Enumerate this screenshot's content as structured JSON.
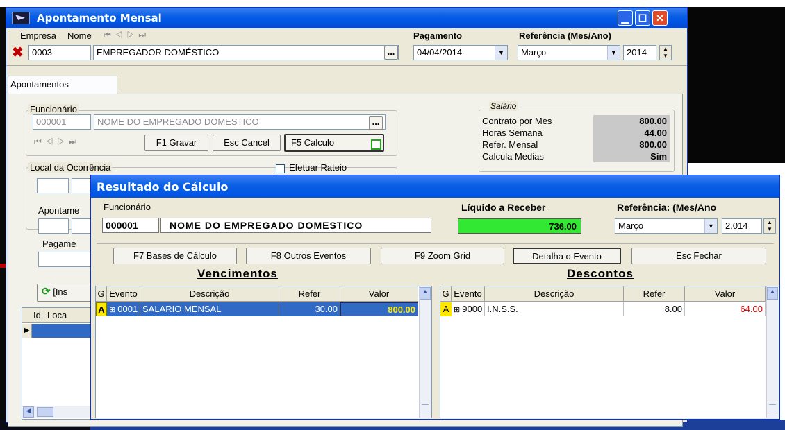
{
  "main_window": {
    "title": "Apontamento Mensal",
    "labels": {
      "empresa": "Empresa",
      "nome": "Nome",
      "pagamento": "Pagamento",
      "referencia": "Referência (Mes/Ano)"
    },
    "empresa_code": "0003",
    "empresa_name": "EMPREGADOR DOMÉSTICO",
    "ellipsis": "...",
    "pagamento_date": "04/04/2014",
    "ref_month": "Março",
    "ref_year": "2014",
    "tab": "Apontamentos",
    "funcionario": {
      "label": "Funcionário",
      "code": "000001",
      "name": "NOME DO EMPREGADO DOMESTICO"
    },
    "buttons": {
      "gravar": "F1 Gravar",
      "cancel": "Esc Cancel",
      "calculo": "F5 Calculo"
    },
    "salario": {
      "title": "Salário",
      "rows": [
        {
          "label": "Contrato por Mes",
          "value": "800.00"
        },
        {
          "label": "Horas Semana",
          "value": "44.00"
        },
        {
          "label": "Refer. Mensal",
          "value": "800.00"
        },
        {
          "label": "Calcula Medias",
          "value": "Sim"
        }
      ]
    },
    "local": "Local da Ocorrência",
    "efetuar_rateio": "Efetuar Rateio",
    "apontamento_cut": "Apontame",
    "pagamento_cut": "Pagame",
    "insert_cut": "[Ins",
    "grid_headers": {
      "id": "Id",
      "loc": "Loca"
    }
  },
  "dialog": {
    "title": "Resultado do Cálculo",
    "labels": {
      "funcionario": "Funcionário",
      "liquido": "Líquido a Receber",
      "referencia": "Referência: (Mes/Ano"
    },
    "func_code": "000001",
    "func_name": "NOME DO EMPREGADO DOMESTICO",
    "liquido_value": "736.00",
    "ref_month": "Março",
    "ref_year": "2,014",
    "buttons": {
      "bases": "F7 Bases de Cálculo",
      "outros": "F8 Outros Eventos",
      "zoom": "F9 Zoom Grid",
      "detalha": "Detalha o Evento",
      "fechar": "Esc Fechar"
    },
    "vencimentos": {
      "title": "Vencimentos",
      "headers": [
        "G",
        "Evento",
        "Descrição",
        "Refer",
        "Valor"
      ],
      "rows": [
        {
          "g": "A",
          "evento": "0001",
          "descricao": "SALARIO MENSAL",
          "refer": "30.00",
          "valor": "800.00"
        }
      ]
    },
    "descontos": {
      "title": "Descontos",
      "headers": [
        "G",
        "Evento",
        "Descrição",
        "Refer",
        "Valor"
      ],
      "rows": [
        {
          "g": "A",
          "evento": "9000",
          "descricao": "I.N.S.S.",
          "refer": "8.00",
          "valor": "64.00"
        }
      ]
    }
  }
}
